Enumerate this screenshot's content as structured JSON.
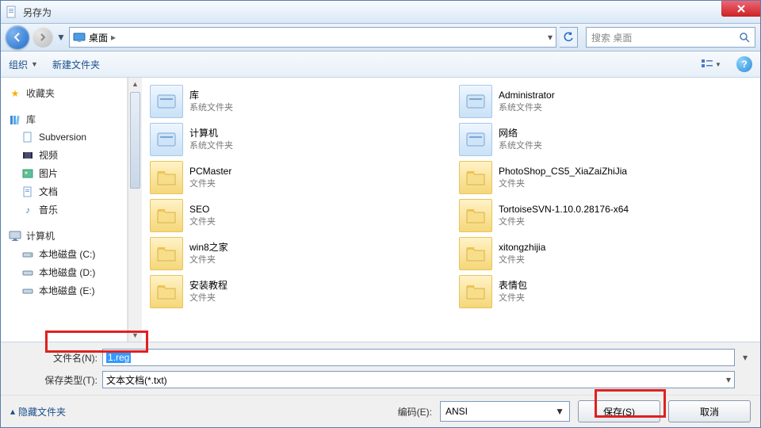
{
  "window": {
    "title": "另存为"
  },
  "nav": {
    "location_icon": "desktop-icon",
    "location_label": "桌面",
    "search_placeholder": "搜索 桌面"
  },
  "toolbar": {
    "organize": "组织",
    "new_folder": "新建文件夹"
  },
  "sidebar": {
    "favorites": "收藏夹",
    "libraries": "库",
    "lib_items": [
      {
        "label": "Subversion"
      },
      {
        "label": "视频"
      },
      {
        "label": "图片"
      },
      {
        "label": "文档"
      },
      {
        "label": "音乐"
      }
    ],
    "computer": "计算机",
    "drives": [
      {
        "label": "本地磁盘 (C:)"
      },
      {
        "label": "本地磁盘 (D:)"
      },
      {
        "label": "本地磁盘 (E:)"
      }
    ]
  },
  "content": {
    "left": [
      {
        "name": "库",
        "sub": "系统文件夹",
        "special": true
      },
      {
        "name": "计算机",
        "sub": "系统文件夹",
        "special": true
      },
      {
        "name": "PCMaster",
        "sub": "文件夹"
      },
      {
        "name": "SEO",
        "sub": "文件夹"
      },
      {
        "name": "win8之家",
        "sub": "文件夹"
      },
      {
        "name": "安装教程",
        "sub": "文件夹"
      }
    ],
    "right": [
      {
        "name": "Administrator",
        "sub": "系统文件夹",
        "special": true
      },
      {
        "name": "网络",
        "sub": "系统文件夹",
        "special": true
      },
      {
        "name": "PhotoShop_CS5_XiaZaiZhiJia",
        "sub": "文件夹"
      },
      {
        "name": "TortoiseSVN-1.10.0.28176-x64",
        "sub": "文件夹"
      },
      {
        "name": "xitongzhijia",
        "sub": "文件夹"
      },
      {
        "name": "表情包",
        "sub": "文件夹"
      }
    ]
  },
  "form": {
    "filename_label": "文件名(N):",
    "filename_value": "1.reg",
    "filetype_label": "保存类型(T):",
    "filetype_value": "文本文档(*.txt)"
  },
  "footer": {
    "hide_folders": "隐藏文件夹",
    "encoding_label": "编码(E):",
    "encoding_value": "ANSI",
    "save": "保存(S)",
    "cancel": "取消"
  }
}
